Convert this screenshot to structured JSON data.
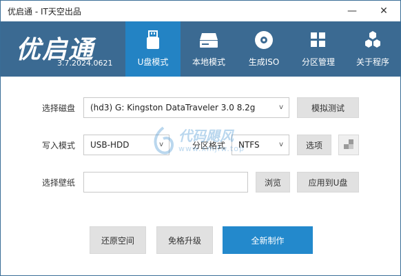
{
  "window": {
    "title": "优启通 - IT天空出品",
    "minimize_glyph": "—",
    "close_glyph": "✕"
  },
  "header": {
    "logo": "优启通",
    "version": "3.7.2024.0621",
    "tabs": [
      {
        "label": "U盘模式",
        "icon": "usb-drive-icon",
        "active": true
      },
      {
        "label": "本地模式",
        "icon": "hard-disk-icon",
        "active": false
      },
      {
        "label": "生成ISO",
        "icon": "disc-icon",
        "active": false
      },
      {
        "label": "分区管理",
        "icon": "partition-grid-icon",
        "active": false
      },
      {
        "label": "关于程序",
        "icon": "hexagon-cluster-icon",
        "active": false
      }
    ]
  },
  "form": {
    "disk_label": "选择磁盘",
    "disk_value": "(hd3) G: Kingston DataTraveler 3.0 8.2g",
    "simulate_button": "模拟测试",
    "write_mode_label": "写入模式",
    "write_mode_value": "USB-HDD",
    "partition_format_label": "分区格式",
    "partition_format_value": "NTFS",
    "options_button": "选项",
    "wallpaper_label": "选择壁纸",
    "wallpaper_value": "",
    "browse_button": "浏览",
    "apply_usb_button": "应用到U盘"
  },
  "actions": {
    "restore_space": "还原空间",
    "free_upgrade": "免格升级",
    "full_create": "全新制作"
  },
  "watermark": {
    "line1": "代码飓风",
    "line2": "www.xmjfw.top"
  },
  "colors": {
    "header_bg": "#3b6a92",
    "active_tab_bg": "#2383c4",
    "primary_button": "#2389cc"
  }
}
